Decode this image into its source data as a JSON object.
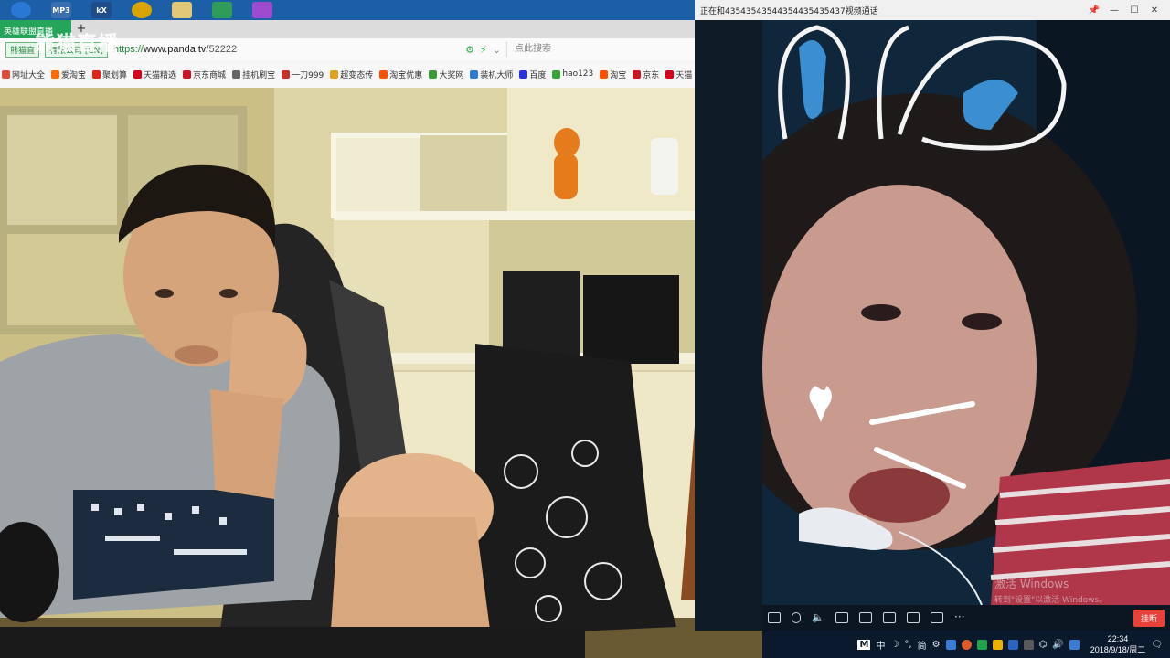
{
  "desktop": {
    "icons": [
      {
        "label": "",
        "color": "#2a78d6"
      },
      {
        "label": "MP3",
        "color": "#3a6fb0"
      },
      {
        "label": "kX",
        "color": "#1f4d8a"
      },
      {
        "label": "",
        "color": "#d9a400"
      },
      {
        "label": "",
        "color": "#e3c778"
      },
      {
        "label": "",
        "color": "#2f9c5a"
      },
      {
        "label": "",
        "color": "#a04ad0"
      }
    ]
  },
  "browser": {
    "tab_label": "英雄联盟直播",
    "new_tab": "+",
    "site_badge_1": "熊猫直",
    "site_badge_2": "有限公司 [CN]",
    "url_scheme": "https://",
    "url_host": "www.panda.tv",
    "url_path": "/52222",
    "search_placeholder": "点此搜索",
    "overlay_logo": "熊猫直播",
    "bookmarks": [
      {
        "label": "网址大全",
        "color": "#e14b3b"
      },
      {
        "label": "爱淘宝",
        "color": "#ff6a00"
      },
      {
        "label": "聚划算",
        "color": "#e2231a"
      },
      {
        "label": "天猫精选",
        "color": "#d9001b"
      },
      {
        "label": "京东商城",
        "color": "#c81623"
      },
      {
        "label": "挂机刷宝",
        "color": "#666666"
      },
      {
        "label": "一刀999",
        "color": "#c7302a"
      },
      {
        "label": "超变态传",
        "color": "#e0a020"
      },
      {
        "label": "淘宝优惠",
        "color": "#ff5000"
      },
      {
        "label": "大奖网",
        "color": "#3a9a3a"
      },
      {
        "label": "装机大师",
        "color": "#2b7bd4"
      },
      {
        "label": "百度",
        "color": "#2932e1"
      },
      {
        "label": "hao123",
        "color": "#3aa33a"
      },
      {
        "label": "淘宝",
        "color": "#ff5000"
      },
      {
        "label": "京东",
        "color": "#c81623"
      },
      {
        "label": "天猫",
        "color": "#d9001b"
      },
      {
        "label": "»",
        "color": "#f7f7f7"
      }
    ]
  },
  "call": {
    "title": "正在和43543543544354435435437视频通话",
    "hangup": "挂断",
    "watermark_1": "激活 Windows",
    "watermark_2": "转到\"设置\"以激活 Windows。"
  },
  "taskbar": {
    "ime_mode": "M",
    "ime_lang": "中",
    "ime_script": "简",
    "time": "22:34",
    "date": "2018/9/18/周二"
  }
}
